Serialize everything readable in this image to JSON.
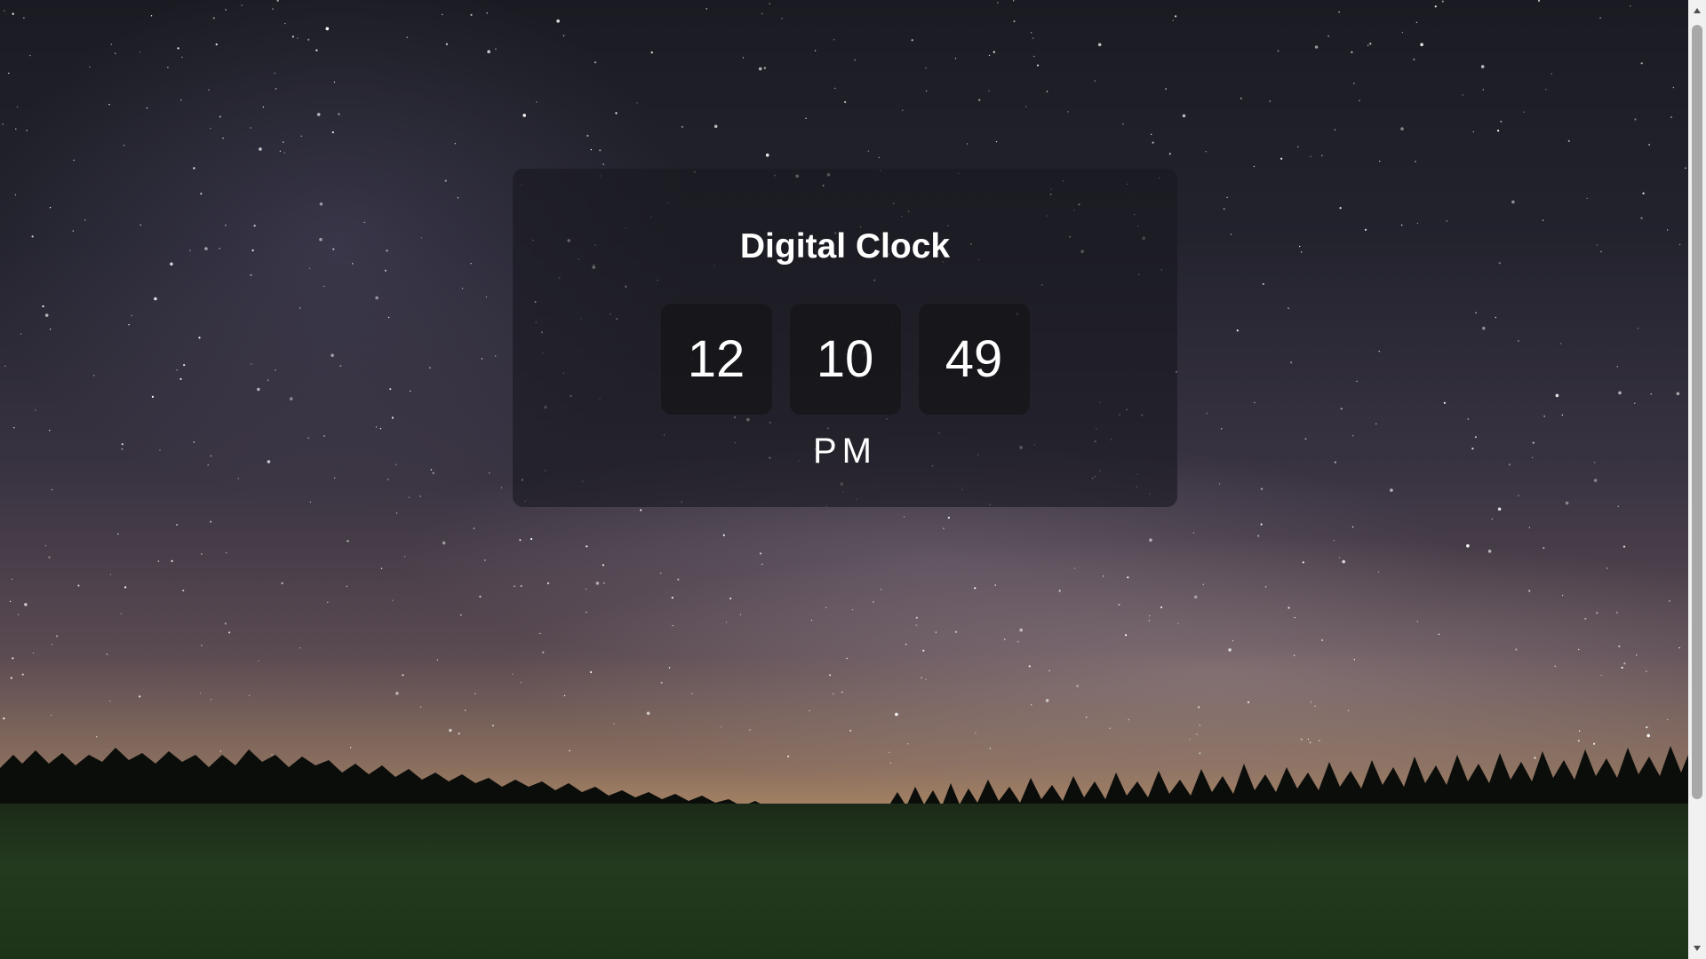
{
  "clock": {
    "title": "Digital Clock",
    "hours": "12",
    "minutes": "10",
    "seconds": "49",
    "period": "PM"
  },
  "background": {
    "scene": "starry-night-sky-over-forest",
    "colors": {
      "sky_top": "#1a1b22",
      "horizon_glow": "#b08a66",
      "treeline": "#0b0d0a",
      "meadow": "#233a1f"
    }
  },
  "scrollbar": {
    "up_icon": "triangle-up-icon",
    "down_icon": "triangle-down-icon"
  }
}
